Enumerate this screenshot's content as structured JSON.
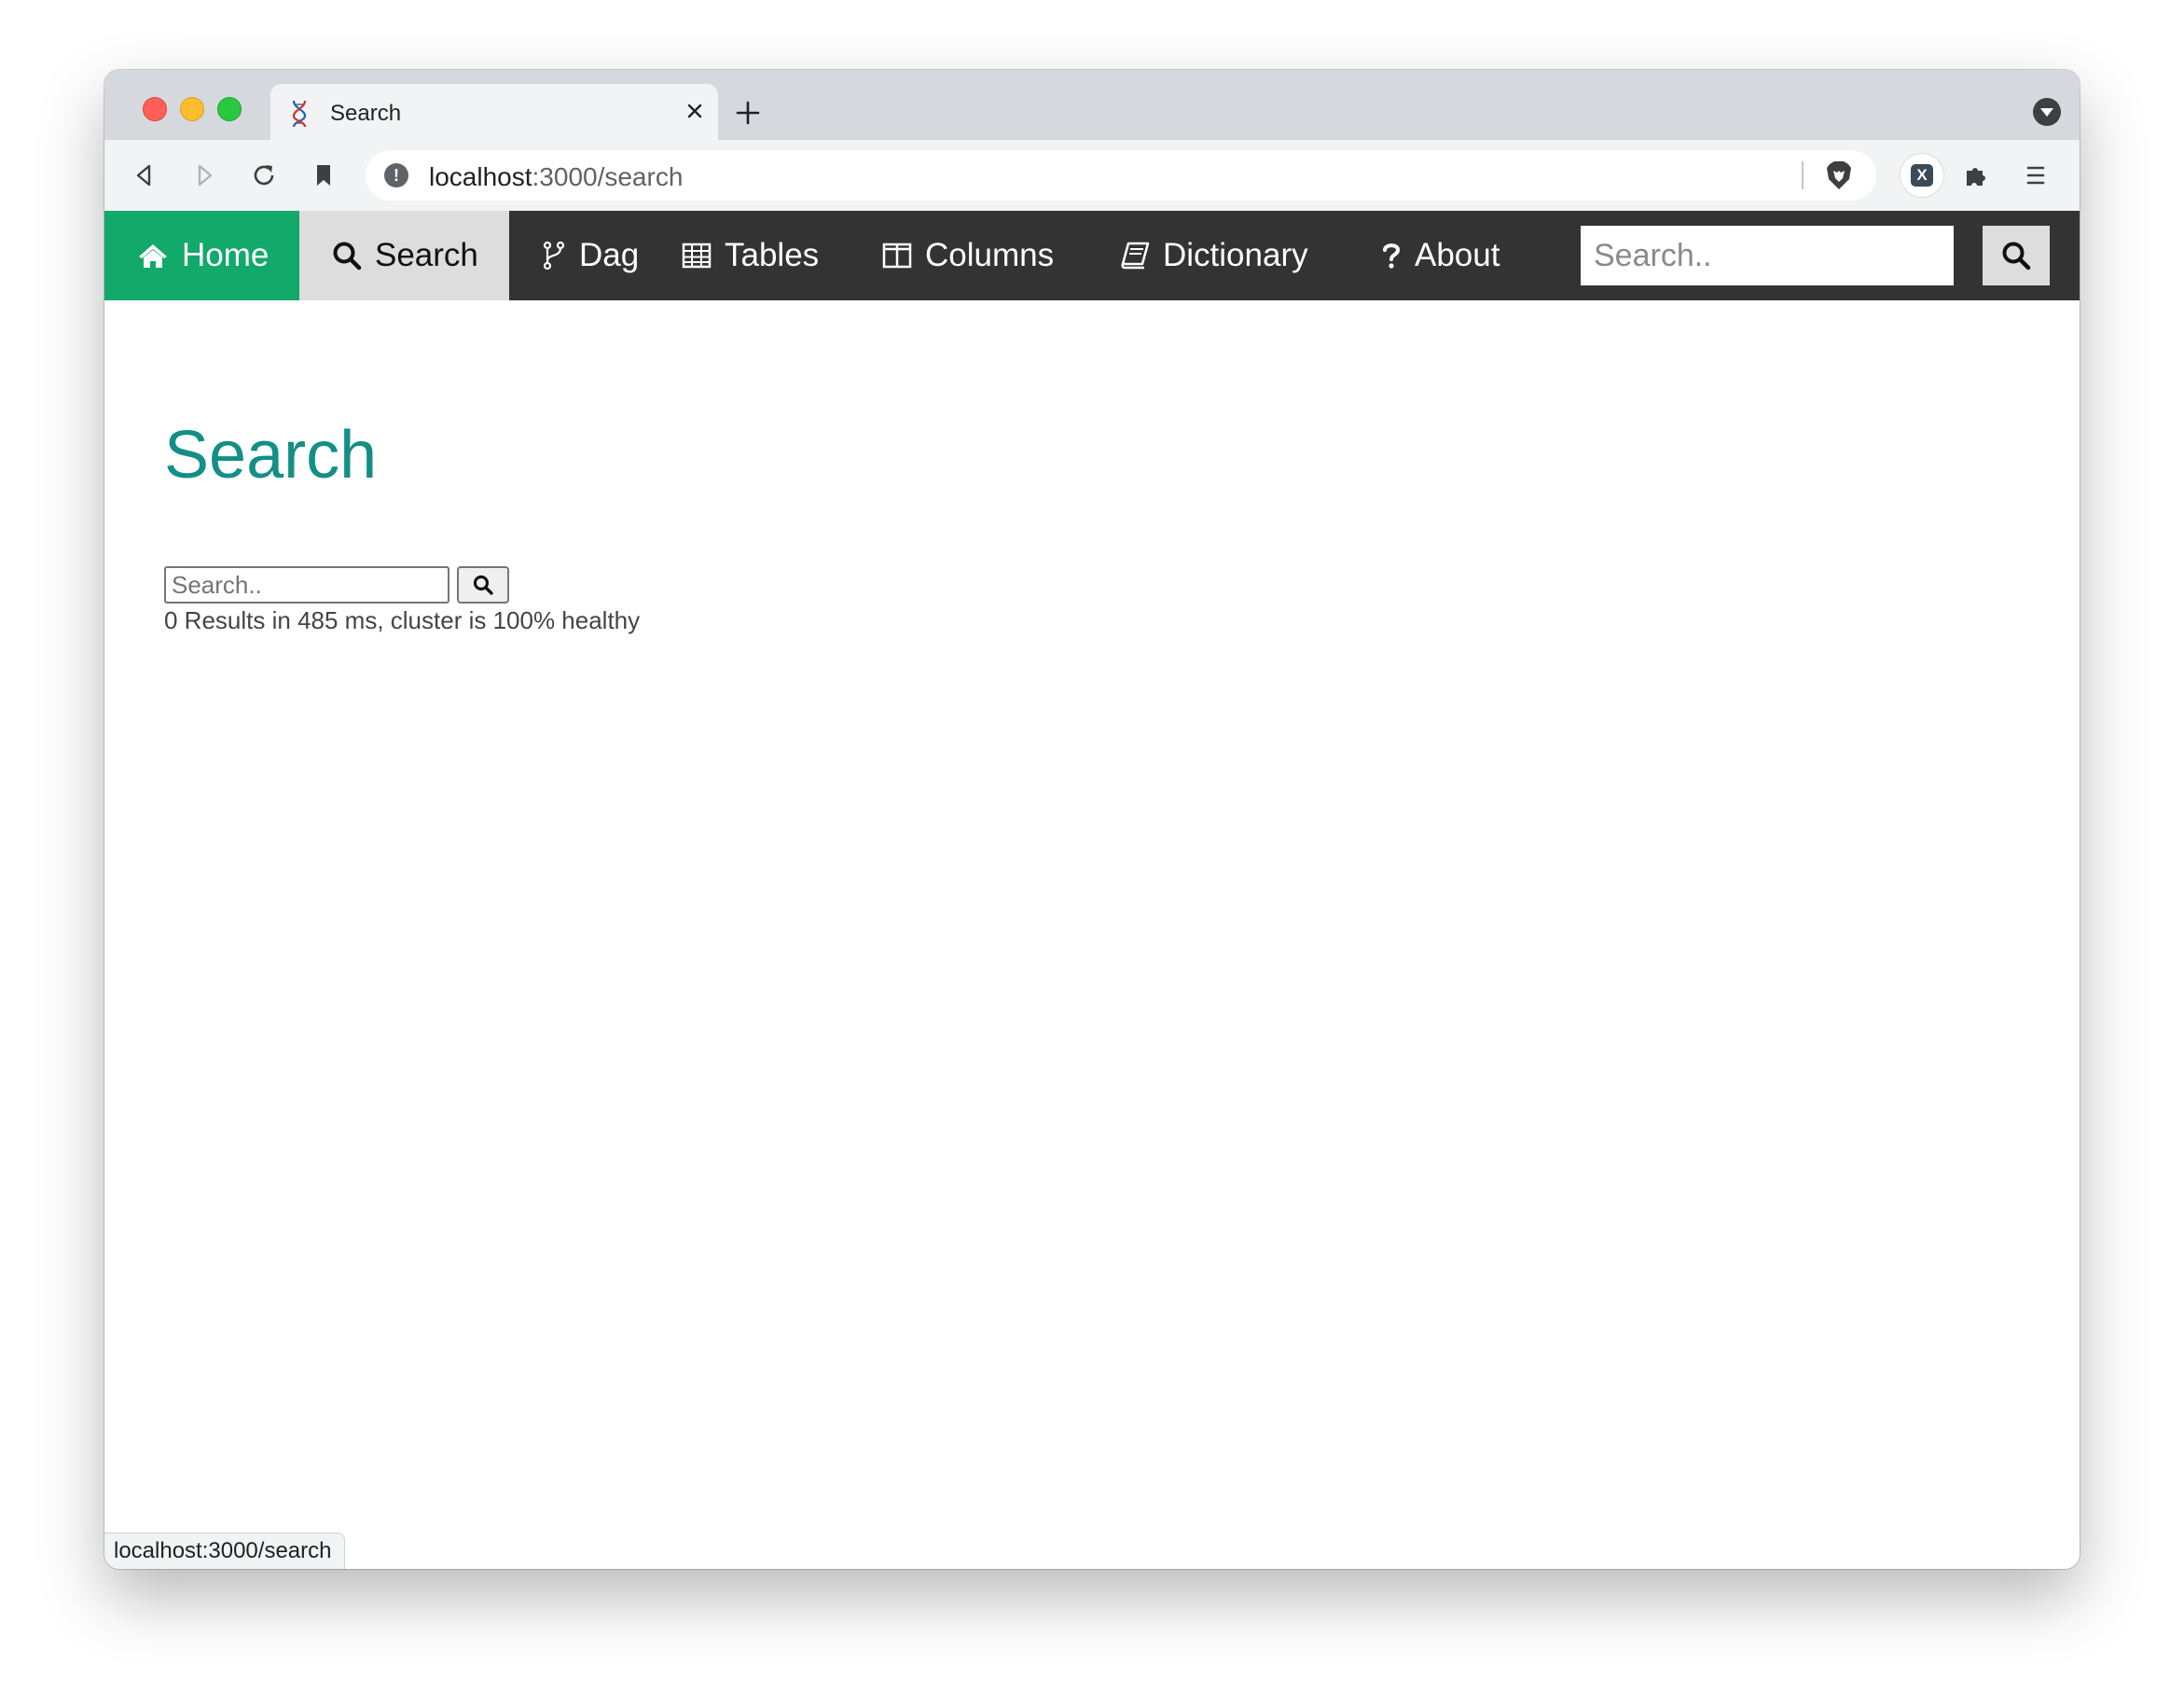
{
  "browser": {
    "tab": {
      "title": "Search"
    },
    "address_bar": {
      "host": "localhost",
      "path": ":3000/search"
    },
    "status_url": "localhost:3000/search"
  },
  "navbar": {
    "items": [
      {
        "label": "Home",
        "icon": "home-icon",
        "active_color": "#12a96a"
      },
      {
        "label": "Search",
        "icon": "search-icon",
        "selected": true
      },
      {
        "label": "Dag",
        "icon": "branch-icon"
      },
      {
        "label": "Tables",
        "icon": "table-icon"
      },
      {
        "label": "Columns",
        "icon": "columns-icon"
      },
      {
        "label": "Dictionary",
        "icon": "book-icon"
      },
      {
        "label": "About",
        "icon": "question-icon"
      }
    ],
    "search": {
      "placeholder": "Search.."
    }
  },
  "content": {
    "title": "Search",
    "search": {
      "placeholder": "Search.."
    },
    "results_summary": "0 Results in 485 ms, cluster is 100% healthy"
  },
  "colors": {
    "navbar_bg": "#333333",
    "home_bg": "#12a96a",
    "title_color": "#138f86"
  }
}
